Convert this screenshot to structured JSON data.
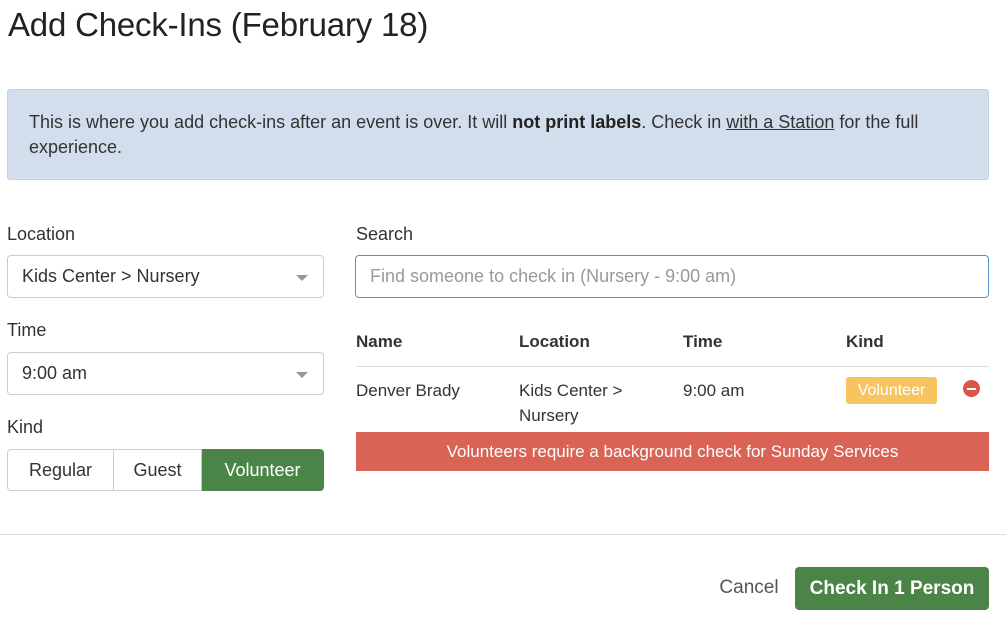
{
  "page": {
    "title": "Add Check-Ins (February 18)"
  },
  "notice": {
    "text_1": "This is where you add check-ins after an event is over. It will ",
    "bold": "not print labels",
    "text_2": ". Check in ",
    "link": "with a Station",
    "text_3": " for the full experience."
  },
  "form": {
    "location_label": "Location",
    "location_value": "Kids Center > Nursery",
    "time_label": "Time",
    "time_value": "9:00 am",
    "kind_label": "Kind",
    "kind_options": [
      "Regular",
      "Guest",
      "Volunteer"
    ],
    "kind_selected": "Volunteer"
  },
  "search": {
    "label": "Search",
    "placeholder": "Find someone to check in (Nursery - 9:00 am)"
  },
  "table": {
    "headers": [
      "Name",
      "Location",
      "Time",
      "Kind"
    ],
    "rows": [
      {
        "name": "Denver Brady",
        "location_line1": "Kids Center >",
        "location_line2": "Nursery",
        "time": "9:00 am",
        "kind": "Volunteer"
      }
    ],
    "warning": "Volunteers require a background check for Sunday Services"
  },
  "footer": {
    "cancel_label": "Cancel",
    "submit_label": "Check In 1 Person"
  },
  "colors": {
    "primary_green": "#4a8547",
    "notice_bg": "#d2deeb",
    "warning_red": "#d96455",
    "badge_yellow": "#f7c45f",
    "focus_blue": "#5b8fd3"
  },
  "icons": {
    "select_caret": "caret-down-icon",
    "remove": "minus-circle-icon"
  }
}
